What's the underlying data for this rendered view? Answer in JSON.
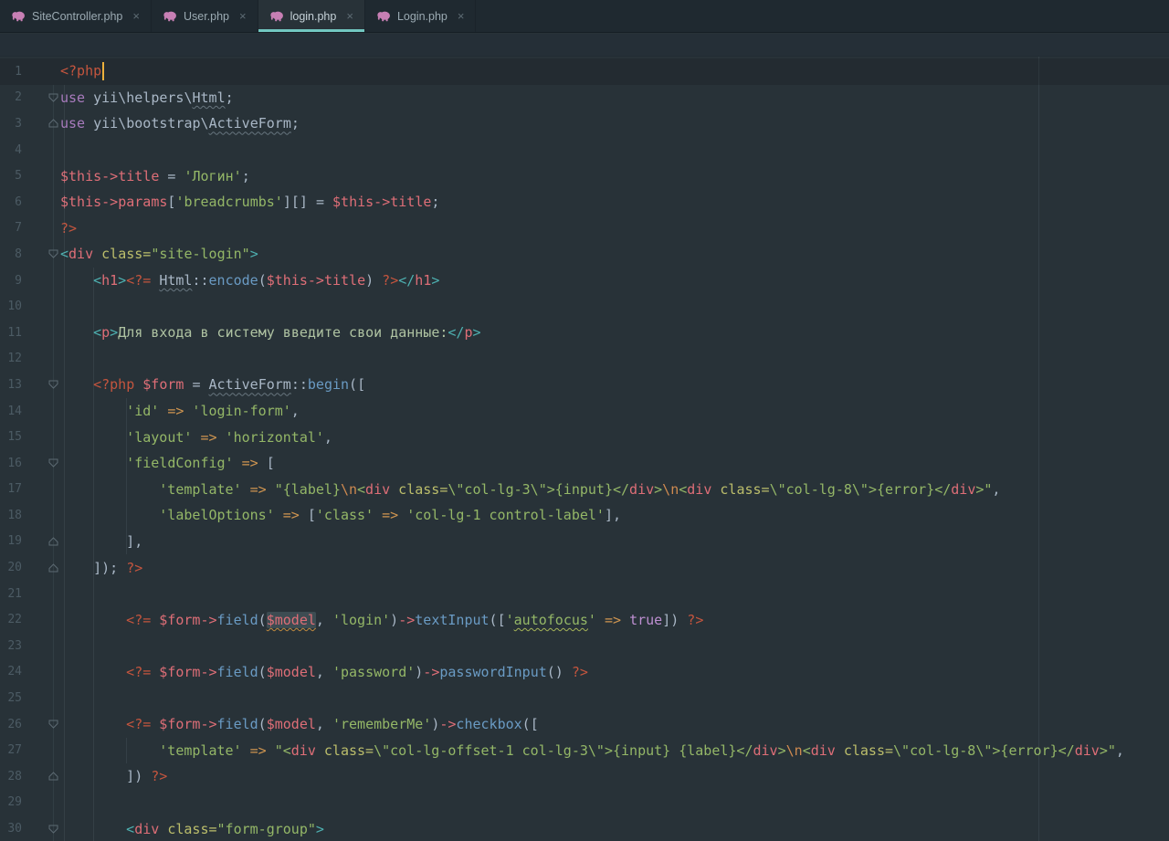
{
  "window": {
    "app": "PhpStorm code editor"
  },
  "colors": {
    "php": "#C4553E",
    "kw": "#A87BBD",
    "pl": "#A9B7C6",
    "var": "#DE6E77",
    "str": "#94B767",
    "esc": "#CF8A50",
    "op": "#CF9550",
    "fn": "#6A9BC4",
    "tb": "#4EB1B1",
    "tag": "#DE6E77",
    "at": "#BCBE6B",
    "tx": "#AFC3A2",
    "bo": "#BE8FD1",
    "caret": "#ECB03C",
    "tabunderline": "#72C7C0",
    "phpicon": "#C77FB4"
  },
  "tabs": [
    {
      "label": "SiteController.php",
      "active": false
    },
    {
      "label": "User.php",
      "active": false
    },
    {
      "label": "login.php",
      "active": true
    },
    {
      "label": "Login.php",
      "active": false
    }
  ],
  "tab_close_glyph": "×",
  "editor": {
    "right_margin_column": 120,
    "fold_markers": {
      "2": "down",
      "3": "up",
      "8": "down",
      "13": "down",
      "16": "down",
      "19": "up",
      "20": "up",
      "26": "down",
      "28": "up",
      "30": "down"
    },
    "lines": [
      {
        "n": 1,
        "indent": 0,
        "caret_after": true,
        "tokens": [
          [
            "php",
            "<?php"
          ]
        ]
      },
      {
        "n": 2,
        "indent": 0,
        "tokens": [
          [
            "kw",
            "use"
          ],
          [
            "pl",
            " yii\\helpers\\"
          ],
          [
            "pl",
            "Html",
            "wg"
          ],
          [
            "pl",
            ";"
          ]
        ]
      },
      {
        "n": 3,
        "indent": 0,
        "tokens": [
          [
            "kw",
            "use"
          ],
          [
            "pl",
            " yii\\bootstrap\\"
          ],
          [
            "pl",
            "ActiveForm",
            "wg"
          ],
          [
            "pl",
            ";"
          ]
        ]
      },
      {
        "n": 4,
        "indent": 0,
        "tokens": []
      },
      {
        "n": 5,
        "indent": 0,
        "tokens": [
          [
            "var",
            "$this->title"
          ],
          [
            "pl",
            " = "
          ],
          [
            "str",
            "'Логин'"
          ],
          [
            "pl",
            ";"
          ]
        ]
      },
      {
        "n": 6,
        "indent": 0,
        "tokens": [
          [
            "var",
            "$this->params"
          ],
          [
            "pl",
            "["
          ],
          [
            "str",
            "'breadcrumbs'"
          ],
          [
            "pl",
            "][] = "
          ],
          [
            "var",
            "$this->title"
          ],
          [
            "pl",
            ";"
          ]
        ]
      },
      {
        "n": 7,
        "indent": 0,
        "tokens": [
          [
            "php",
            "?>"
          ]
        ]
      },
      {
        "n": 8,
        "indent": 0,
        "tokens": [
          [
            "tb",
            "<"
          ],
          [
            "tag",
            "div"
          ],
          [
            "pl",
            " "
          ],
          [
            "at",
            "class="
          ],
          [
            "str",
            "\"site-login\""
          ],
          [
            "tb",
            ">"
          ]
        ]
      },
      {
        "n": 9,
        "indent": 4,
        "tokens": [
          [
            "tb",
            "<"
          ],
          [
            "tag",
            "h1"
          ],
          [
            "tb",
            ">"
          ],
          [
            "php",
            "<?= "
          ],
          [
            "pl",
            "Html",
            "wg"
          ],
          [
            "pl",
            "::"
          ],
          [
            "fn",
            "encode"
          ],
          [
            "pl",
            "("
          ],
          [
            "var",
            "$this->title"
          ],
          [
            "pl",
            ") "
          ],
          [
            "php",
            "?>"
          ],
          [
            "tb",
            "</"
          ],
          [
            "tag",
            "h1"
          ],
          [
            "tb",
            ">"
          ]
        ]
      },
      {
        "n": 10,
        "indent": 0,
        "tokens": []
      },
      {
        "n": 11,
        "indent": 4,
        "tokens": [
          [
            "tb",
            "<"
          ],
          [
            "tag",
            "p"
          ],
          [
            "tb",
            ">"
          ],
          [
            "tx",
            "Для входа в систему введите свои данные:"
          ],
          [
            "tb",
            "</"
          ],
          [
            "tag",
            "p"
          ],
          [
            "tb",
            ">"
          ]
        ]
      },
      {
        "n": 12,
        "indent": 0,
        "tokens": []
      },
      {
        "n": 13,
        "indent": 4,
        "tokens": [
          [
            "php",
            "<?php "
          ],
          [
            "var",
            "$form"
          ],
          [
            "pl",
            " = "
          ],
          [
            "pl",
            "ActiveForm",
            "wg"
          ],
          [
            "pl",
            "::"
          ],
          [
            "fn",
            "begin"
          ],
          [
            "pl",
            "(["
          ]
        ]
      },
      {
        "n": 14,
        "indent": 8,
        "tokens": [
          [
            "str",
            "'id'"
          ],
          [
            "pl",
            " "
          ],
          [
            "op",
            "=>"
          ],
          [
            "pl",
            " "
          ],
          [
            "str",
            "'login-form'"
          ],
          [
            "pl",
            ","
          ]
        ]
      },
      {
        "n": 15,
        "indent": 8,
        "tokens": [
          [
            "str",
            "'layout'"
          ],
          [
            "pl",
            " "
          ],
          [
            "op",
            "=>"
          ],
          [
            "pl",
            " "
          ],
          [
            "str",
            "'horizontal'"
          ],
          [
            "pl",
            ","
          ]
        ]
      },
      {
        "n": 16,
        "indent": 8,
        "tokens": [
          [
            "str",
            "'fieldConfig'"
          ],
          [
            "pl",
            " "
          ],
          [
            "op",
            "=>"
          ],
          [
            "pl",
            " ["
          ]
        ]
      },
      {
        "n": 17,
        "indent": 12,
        "tokens": [
          [
            "str",
            "'template'"
          ],
          [
            "pl",
            " "
          ],
          [
            "op",
            "=>"
          ],
          [
            "pl",
            " "
          ],
          [
            "str",
            "\"{label}"
          ],
          [
            "esc",
            "\\n"
          ],
          [
            "str",
            "<"
          ],
          [
            "tag",
            "div"
          ],
          [
            "str",
            " "
          ],
          [
            "at",
            "class="
          ],
          [
            "str",
            "\\\"col-lg-3\\\">{input}</"
          ],
          [
            "tag",
            "div"
          ],
          [
            "str",
            ">"
          ],
          [
            "esc",
            "\\n"
          ],
          [
            "str",
            "<"
          ],
          [
            "tag",
            "div"
          ],
          [
            "str",
            " "
          ],
          [
            "at",
            "class="
          ],
          [
            "str",
            "\\\"col-lg-8\\\">{error}</"
          ],
          [
            "tag",
            "div"
          ],
          [
            "str",
            ">\""
          ],
          [
            "pl",
            ","
          ]
        ]
      },
      {
        "n": 18,
        "indent": 12,
        "tokens": [
          [
            "str",
            "'labelOptions'"
          ],
          [
            "pl",
            " "
          ],
          [
            "op",
            "=>"
          ],
          [
            "pl",
            " ["
          ],
          [
            "str",
            "'class'"
          ],
          [
            "pl",
            " "
          ],
          [
            "op",
            "=>"
          ],
          [
            "pl",
            " "
          ],
          [
            "str",
            "'col-lg-1 control-label'"
          ],
          [
            "pl",
            "],"
          ]
        ]
      },
      {
        "n": 19,
        "indent": 8,
        "tokens": [
          [
            "pl",
            "],"
          ]
        ]
      },
      {
        "n": 20,
        "indent": 4,
        "tokens": [
          [
            "pl",
            "]); "
          ],
          [
            "php",
            "?>"
          ]
        ]
      },
      {
        "n": 21,
        "indent": 0,
        "tokens": []
      },
      {
        "n": 22,
        "indent": 8,
        "tokens": [
          [
            "php",
            "<?= "
          ],
          [
            "var",
            "$form"
          ],
          [
            "var",
            "->"
          ],
          [
            "fn",
            "field"
          ],
          [
            "pl",
            "("
          ],
          [
            "var",
            "$model",
            "boxhl wo"
          ],
          [
            "pl",
            ", "
          ],
          [
            "str",
            "'login'"
          ],
          [
            "pl",
            ")"
          ],
          [
            "var",
            "->"
          ],
          [
            "fn",
            "textInput"
          ],
          [
            "pl",
            "(["
          ],
          [
            "str",
            "'"
          ],
          [
            "str",
            "autofocus",
            "wy"
          ],
          [
            "str",
            "'"
          ],
          [
            "pl",
            " "
          ],
          [
            "op",
            "=>"
          ],
          [
            "pl",
            " "
          ],
          [
            "bo",
            "true"
          ],
          [
            "pl",
            "]) "
          ],
          [
            "php",
            "?>"
          ]
        ]
      },
      {
        "n": 23,
        "indent": 0,
        "tokens": []
      },
      {
        "n": 24,
        "indent": 8,
        "tokens": [
          [
            "php",
            "<?= "
          ],
          [
            "var",
            "$form"
          ],
          [
            "var",
            "->"
          ],
          [
            "fn",
            "field"
          ],
          [
            "pl",
            "("
          ],
          [
            "var",
            "$model"
          ],
          [
            "pl",
            ", "
          ],
          [
            "str",
            "'password'"
          ],
          [
            "pl",
            ")"
          ],
          [
            "var",
            "->"
          ],
          [
            "fn",
            "passwordInput"
          ],
          [
            "pl",
            "() "
          ],
          [
            "php",
            "?>"
          ]
        ]
      },
      {
        "n": 25,
        "indent": 0,
        "tokens": []
      },
      {
        "n": 26,
        "indent": 8,
        "tokens": [
          [
            "php",
            "<?= "
          ],
          [
            "var",
            "$form"
          ],
          [
            "var",
            "->"
          ],
          [
            "fn",
            "field"
          ],
          [
            "pl",
            "("
          ],
          [
            "var",
            "$model"
          ],
          [
            "pl",
            ", "
          ],
          [
            "str",
            "'rememberMe'"
          ],
          [
            "pl",
            ")"
          ],
          [
            "var",
            "->"
          ],
          [
            "fn",
            "checkbox"
          ],
          [
            "pl",
            "(["
          ]
        ]
      },
      {
        "n": 27,
        "indent": 12,
        "tokens": [
          [
            "str",
            "'template'"
          ],
          [
            "pl",
            " "
          ],
          [
            "op",
            "=>"
          ],
          [
            "pl",
            " "
          ],
          [
            "str",
            "\"<"
          ],
          [
            "tag",
            "div"
          ],
          [
            "str",
            " "
          ],
          [
            "at",
            "class="
          ],
          [
            "str",
            "\\\"col-lg-offset-1 col-lg-3\\\">{input} {label}</"
          ],
          [
            "tag",
            "div"
          ],
          [
            "str",
            ">"
          ],
          [
            "esc",
            "\\n"
          ],
          [
            "str",
            "<"
          ],
          [
            "tag",
            "div"
          ],
          [
            "str",
            " "
          ],
          [
            "at",
            "class="
          ],
          [
            "str",
            "\\\"col-lg-8\\\">{error}</"
          ],
          [
            "tag",
            "div"
          ],
          [
            "str",
            ">\""
          ],
          [
            "pl",
            ","
          ]
        ]
      },
      {
        "n": 28,
        "indent": 8,
        "tokens": [
          [
            "pl",
            "]) "
          ],
          [
            "php",
            "?>"
          ]
        ]
      },
      {
        "n": 29,
        "indent": 0,
        "tokens": []
      },
      {
        "n": 30,
        "indent": 8,
        "tokens": [
          [
            "tb",
            "<"
          ],
          [
            "tag",
            "div"
          ],
          [
            "pl",
            " "
          ],
          [
            "at",
            "class="
          ],
          [
            "str",
            "\"form-group\""
          ],
          [
            "tb",
            ">"
          ]
        ]
      }
    ]
  }
}
